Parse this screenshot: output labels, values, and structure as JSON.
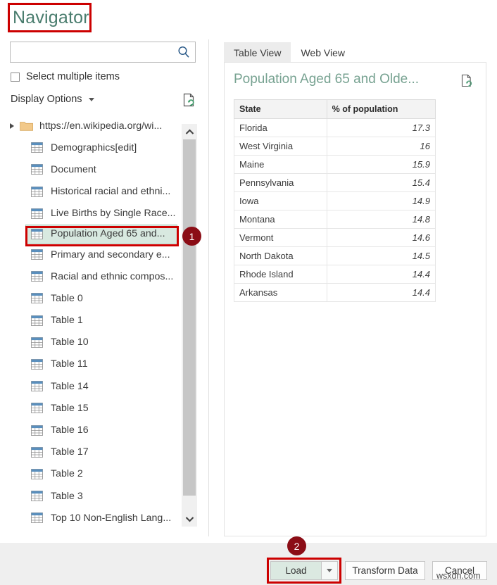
{
  "window": {
    "title": "Navigator"
  },
  "search": {
    "value": "",
    "placeholder": "",
    "icon": "search-icon"
  },
  "options": {
    "select_multiple_label": "Select multiple items",
    "select_multiple_checked": false,
    "display_options_label": "Display Options",
    "refresh_icon": "page-refresh-icon"
  },
  "tree": {
    "root": {
      "label": "https://en.wikipedia.org/wi...",
      "icon": "folder-icon",
      "expanded": true
    },
    "items": [
      {
        "label": "Demographics[edit]",
        "icon": "table-icon",
        "selected": false
      },
      {
        "label": "Document",
        "icon": "table-icon",
        "selected": false
      },
      {
        "label": "Historical racial and ethni...",
        "icon": "table-icon",
        "selected": false
      },
      {
        "label": "Live Births by Single Race...",
        "icon": "table-icon",
        "selected": false
      },
      {
        "label": "Population Aged 65 and...",
        "icon": "table-icon",
        "selected": true
      },
      {
        "label": "Primary and secondary e...",
        "icon": "table-icon",
        "selected": false
      },
      {
        "label": "Racial and ethnic compos...",
        "icon": "table-icon",
        "selected": false
      },
      {
        "label": "Table 0",
        "icon": "table-icon",
        "selected": false
      },
      {
        "label": "Table 1",
        "icon": "table-icon",
        "selected": false
      },
      {
        "label": "Table 10",
        "icon": "table-icon",
        "selected": false
      },
      {
        "label": "Table 11",
        "icon": "table-icon",
        "selected": false
      },
      {
        "label": "Table 14",
        "icon": "table-icon",
        "selected": false
      },
      {
        "label": "Table 15",
        "icon": "table-icon",
        "selected": false
      },
      {
        "label": "Table 16",
        "icon": "table-icon",
        "selected": false
      },
      {
        "label": "Table 17",
        "icon": "table-icon",
        "selected": false
      },
      {
        "label": "Table 2",
        "icon": "table-icon",
        "selected": false
      },
      {
        "label": "Table 3",
        "icon": "table-icon",
        "selected": false
      },
      {
        "label": "Top 10 Non-English Lang...",
        "icon": "table-icon",
        "selected": false
      }
    ]
  },
  "preview": {
    "tabs": [
      {
        "label": "Table View",
        "active": true
      },
      {
        "label": "Web View",
        "active": false
      }
    ],
    "title": "Population Aged 65 and Olde...",
    "refresh_icon": "page-refresh-icon",
    "table": {
      "columns": [
        "State",
        "% of population"
      ],
      "rows": [
        [
          "Florida",
          "17.3"
        ],
        [
          "West Virginia",
          "16"
        ],
        [
          "Maine",
          "15.9"
        ],
        [
          "Pennsylvania",
          "15.4"
        ],
        [
          "Iowa",
          "14.9"
        ],
        [
          "Montana",
          "14.8"
        ],
        [
          "Vermont",
          "14.6"
        ],
        [
          "North Dakota",
          "14.5"
        ],
        [
          "Rhode Island",
          "14.4"
        ],
        [
          "Arkansas",
          "14.4"
        ]
      ]
    }
  },
  "footer": {
    "load_label": "Load",
    "load_dropdown_icon": "chevron-down-icon",
    "transform_label": "Transform Data",
    "cancel_label": "Cancel"
  },
  "annotations": {
    "badge_1": "1",
    "badge_2": "2",
    "highlight_color": "#cc0000",
    "badge_color": "#8b0d16"
  },
  "watermark": {
    "text": "wsxdn.com"
  }
}
